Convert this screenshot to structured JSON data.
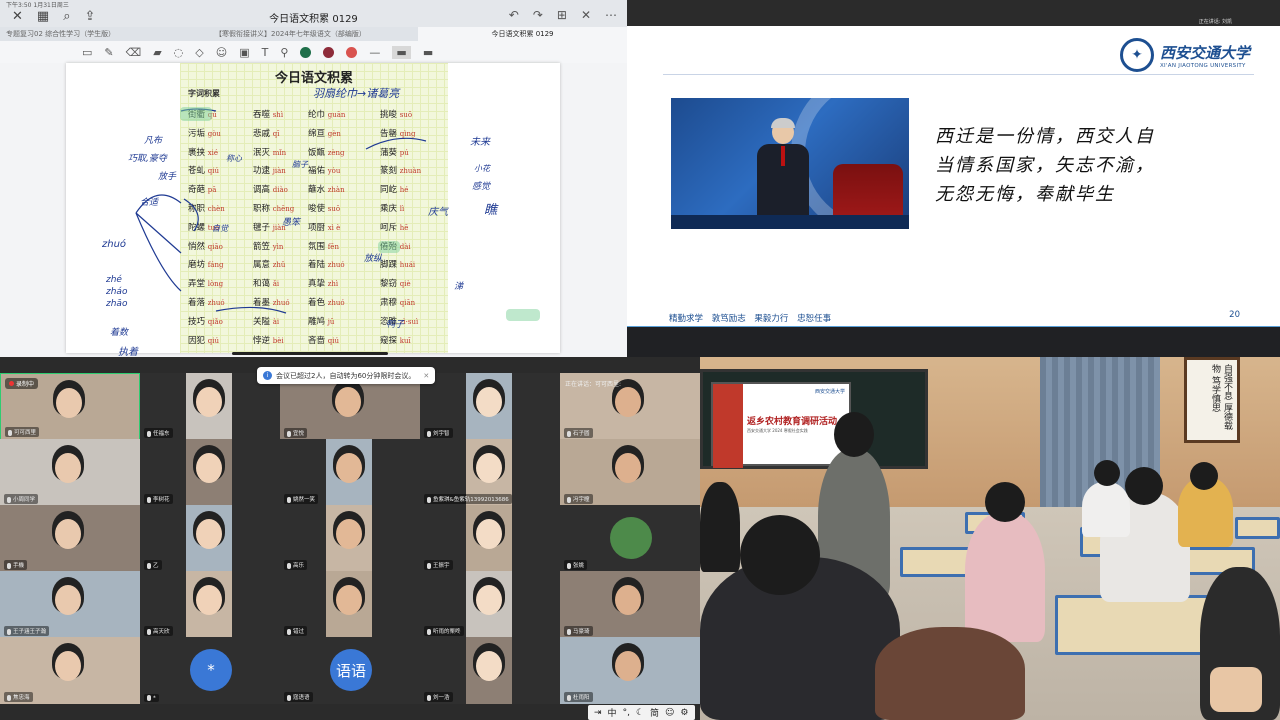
{
  "notes": {
    "status_time": "下午3:50  1月31日周三",
    "doc_title": "今日语文积累 0129",
    "tabs": [
      "专题复习02 综合性学习（学生版）",
      "【寒假衔接讲义】2024年七年级语文（部编版）",
      "今日语文积累 0129"
    ],
    "toolbar_colors": [
      "#1f6f4a",
      "#8e2c3a",
      "#d9534f"
    ],
    "sheet": {
      "title": "今日语文积累",
      "section_label": "字词积累",
      "words": [
        {
          "w": "街衢",
          "p": "qú"
        },
        {
          "w": "吞噬",
          "p": "shì"
        },
        {
          "w": "纶巾",
          "p": "guān"
        },
        {
          "w": "挑唆",
          "p": "suō"
        },
        {
          "w": "污垢",
          "p": "gòu"
        },
        {
          "w": "悲戚",
          "p": "qī"
        },
        {
          "w": "绵亘",
          "p": "gèn"
        },
        {
          "w": "告罄",
          "p": "qìng"
        },
        {
          "w": "裹挟",
          "p": "xié"
        },
        {
          "w": "泯灭",
          "p": "mǐn"
        },
        {
          "w": "饭甑",
          "p": "zèng"
        },
        {
          "w": "蒲葵",
          "p": "pú"
        },
        {
          "w": "苍虬",
          "p": "qiú"
        },
        {
          "w": "功逮",
          "p": "jiàn"
        },
        {
          "w": "福佑",
          "p": "yòu"
        },
        {
          "w": "篆刻",
          "p": "zhuàn"
        },
        {
          "w": "奇葩",
          "p": "pā"
        },
        {
          "w": "调高",
          "p": "diào"
        },
        {
          "w": "蘸水",
          "p": "zhàn"
        },
        {
          "w": "同屹",
          "p": "hé"
        },
        {
          "w": "称职",
          "p": "chèn"
        },
        {
          "w": "职称",
          "p": "chēng"
        },
        {
          "w": "唆使",
          "p": "suō"
        },
        {
          "w": "乘庆",
          "p": "lì"
        },
        {
          "w": "陀螺",
          "p": "tuó"
        },
        {
          "w": "毽子",
          "p": "jiàn"
        },
        {
          "w": "项厨",
          "p": "xì è"
        },
        {
          "w": "呵斥",
          "p": "hē"
        },
        {
          "w": "悄然",
          "p": "qiāo"
        },
        {
          "w": "箭笠",
          "p": "yìn"
        },
        {
          "w": "氛围",
          "p": "fēn"
        },
        {
          "w": "倦殆",
          "p": "dài"
        },
        {
          "w": "磨坊",
          "p": "fáng"
        },
        {
          "w": "属意",
          "p": "zhǔ"
        },
        {
          "w": "着陆",
          "p": "zhuó"
        },
        {
          "w": "脚踝",
          "p": "huái"
        },
        {
          "w": "弄堂",
          "p": "lòng"
        },
        {
          "w": "和蔼",
          "p": "ǎi"
        },
        {
          "w": "真挚",
          "p": "zhì"
        },
        {
          "w": "黎窃",
          "p": "qiè"
        },
        {
          "w": "着落",
          "p": "zhuó"
        },
        {
          "w": "着墨",
          "p": "zhuó"
        },
        {
          "w": "着色",
          "p": "zhuó"
        },
        {
          "w": "肃穆",
          "p": "qiān"
        },
        {
          "w": "技巧",
          "p": "qiǎo"
        },
        {
          "w": "关隘",
          "p": "ài"
        },
        {
          "w": "雕鸠",
          "p": "jū"
        },
        {
          "w": "恣睢",
          "p": "zì·suì"
        },
        {
          "w": "因犯",
          "p": "qiú"
        },
        {
          "w": "悖逆",
          "p": "bèi"
        },
        {
          "w": "吝啬",
          "p": "qiú"
        },
        {
          "w": "窥探",
          "p": "kuī"
        }
      ],
      "annotations": [
        "羽扇纶巾→诸葛亮",
        "凡布",
        "巧取,豪夺",
        "放手",
        "zhuó",
        "zhé",
        "zháo",
        "zhāo",
        "着数",
        "执着",
        "自觉",
        "称心",
        "感觉",
        "涕",
        "脑子",
        "愚笨",
        "放纵",
        "鸭子",
        "合适",
        "未来",
        "庆气",
        "瞧",
        "小花"
      ]
    }
  },
  "slide": {
    "speaker_chip": "正在讲话: 刘凯",
    "logo_cn": "西安交通大学",
    "logo_en": "XI'AN JIAOTONG UNIVERSITY",
    "poem_lines": [
      "西迁是一份情，西交人自",
      "当情系国家，矢志不渝，",
      "无怨无悔，奉献毕生"
    ],
    "motto": "精勤求学  敦笃励志  果毅力行  忠恕任事",
    "page_number": "20"
  },
  "meeting": {
    "recording_label": "录制中",
    "toast": "会议已超过2人，自动转为60分钟限时会议。",
    "speaking_now": "正在讲话：可可西里:",
    "participants": [
      [
        "可可西里",
        "任福东",
        "宜悦",
        "刘宇智",
        "石子圆"
      ],
      [
        "小周同学",
        "李树花",
        "姚然一笑",
        "鱼紫琪&鱼紫轨13992013686",
        "冯宇瞳"
      ],
      [
        "手機",
        "乙",
        "高乐",
        "王振宇",
        "张姚"
      ],
      [
        "王子涵王子瀚",
        "高天欣",
        "错过",
        "听雨的栗咚",
        "马豪琦"
      ],
      [
        "焦忠海",
        "*",
        "寇语语",
        "刘一浩",
        "杜雨阳"
      ]
    ],
    "avatar_star": "*",
    "avatar_yuyu": "语语"
  },
  "ime": {
    "items": [
      "中",
      "简"
    ]
  },
  "classroom": {
    "screen_title": "返乡农村教育调研活动",
    "screen_sub": "西安交通大学 2024 寒假社会实践",
    "screen_logo": "西安交通大学",
    "calligraphy": "自强不息 厚德载物 笃学慎思"
  }
}
